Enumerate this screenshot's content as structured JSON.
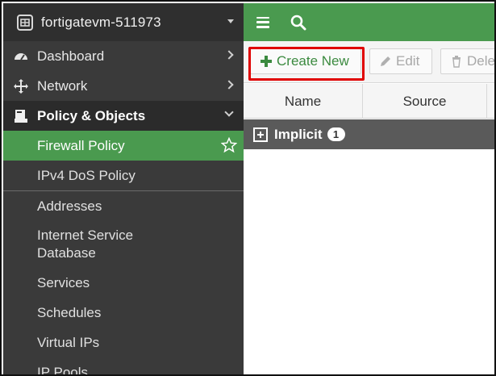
{
  "sidebar": {
    "device_name": "fortigatevm-511973",
    "nav": [
      {
        "label": "Dashboard",
        "icon": "dashboard-icon"
      },
      {
        "label": "Network",
        "icon": "network-icon"
      },
      {
        "label": "Policy & Objects",
        "icon": "policy-icon"
      }
    ],
    "sub_items": [
      {
        "label": "Firewall Policy"
      },
      {
        "label": "IPv4 DoS Policy"
      },
      {
        "label": "Addresses"
      },
      {
        "label": "Internet Service\nDatabase"
      },
      {
        "label": "Services"
      },
      {
        "label": "Schedules"
      },
      {
        "label": "Virtual IPs"
      },
      {
        "label": "IP Pools"
      }
    ]
  },
  "toolbar": {
    "create_label": "Create New",
    "edit_label": "Edit",
    "delete_label": "Dele"
  },
  "table": {
    "columns": [
      "Name",
      "Source"
    ],
    "group": {
      "label": "Implicit",
      "count": "1"
    }
  },
  "colors": {
    "accent_green": "#4a9a4f",
    "sidebar_bg": "#3a3a3a",
    "highlight_red": "#e00000"
  }
}
